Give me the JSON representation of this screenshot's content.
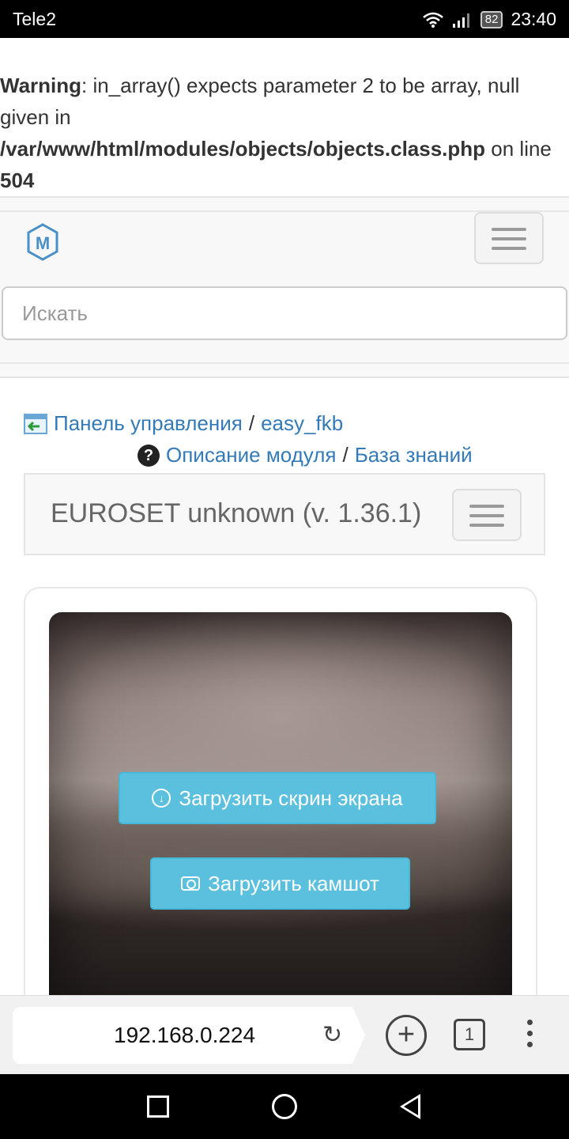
{
  "status_bar": {
    "carrier": "Tele2",
    "battery": "82",
    "time": "23:40"
  },
  "warning": {
    "label": "Warning",
    "text1": ": in_array() expects parameter 2 to be array, null given in",
    "path": "/var/www/html/modules/objects/objects.class.php",
    "text2": " on line ",
    "line": "504"
  },
  "navbar": {
    "logo_letter": "M",
    "search_placeholder": "Искать"
  },
  "breadcrumb": {
    "item1": "Панель управления",
    "sep": "/",
    "item2": "easy_fkb",
    "help_icon_glyph": "?",
    "link1": "Описание модуля",
    "link2": "База знаний"
  },
  "module_header": {
    "title": "EUROSET unknown (v. 1.36.1)"
  },
  "panel": {
    "btn_screenshot": "Загрузить скрин экрана",
    "btn_camshot": "Загрузить камшот"
  },
  "browser": {
    "url": "192.168.0.224",
    "tab_count": "1",
    "reload_glyph": "↻",
    "plus_glyph": "+"
  },
  "colors": {
    "link": "#337ab7",
    "info_button": "#5bc0de"
  }
}
